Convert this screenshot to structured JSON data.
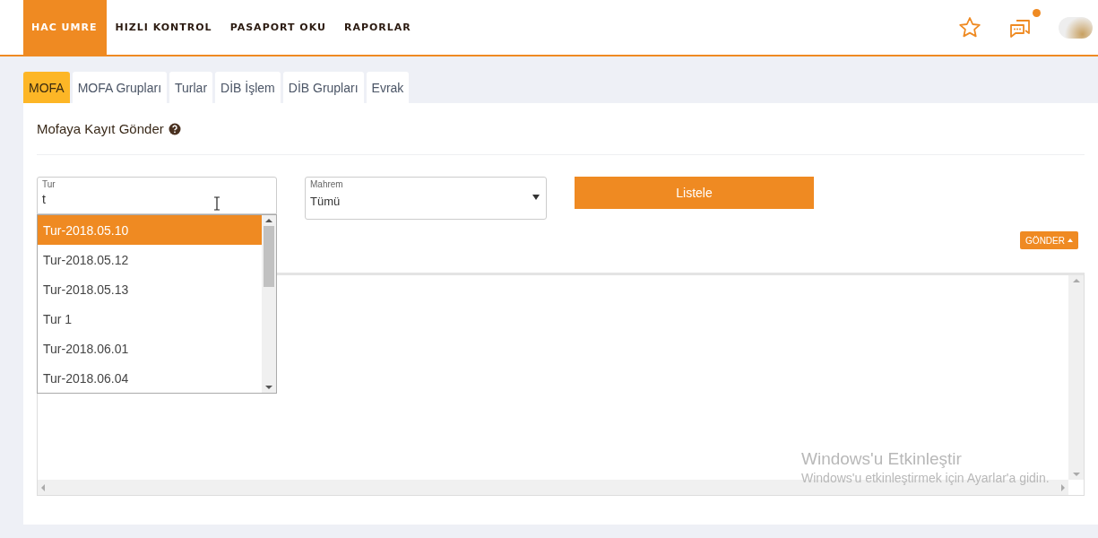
{
  "nav": {
    "items": [
      {
        "label": "HAC UMRE",
        "selected": true
      },
      {
        "label": "HIZLI KONTROL",
        "selected": false
      },
      {
        "label": "PASAPORT OKU",
        "selected": false
      },
      {
        "label": "RAPORLAR",
        "selected": false
      }
    ],
    "notification": true
  },
  "tabs": [
    {
      "label": "MOFA",
      "selected": true
    },
    {
      "label": "MOFA Grupları",
      "selected": false
    },
    {
      "label": "Turlar",
      "selected": false
    },
    {
      "label": "DİB İşlem",
      "selected": false
    },
    {
      "label": "DİB Grupları",
      "selected": false
    },
    {
      "label": "Evrak",
      "selected": false
    }
  ],
  "heading": "Mofaya Kayıt Gönder",
  "tur_field": {
    "label": "Tur",
    "value": "t",
    "options": [
      {
        "label": "Tur-2018.05.10",
        "selected": true
      },
      {
        "label": "Tur-2018.05.12",
        "selected": false
      },
      {
        "label": "Tur-2018.05.13",
        "selected": false
      },
      {
        "label": "Tur 1",
        "selected": false
      },
      {
        "label": "Tur-2018.06.01",
        "selected": false
      },
      {
        "label": "Tur-2018.06.04",
        "selected": false
      }
    ]
  },
  "mahrem_field": {
    "label": "Mahrem",
    "value": "Tümü"
  },
  "list_button": "Listele",
  "send_button": "GÖNDER",
  "activation_notice": {
    "title": "Windows'u Etkinleştir",
    "text": "Windows'u etkinleştirmek için Ayarlar'a gidin."
  }
}
